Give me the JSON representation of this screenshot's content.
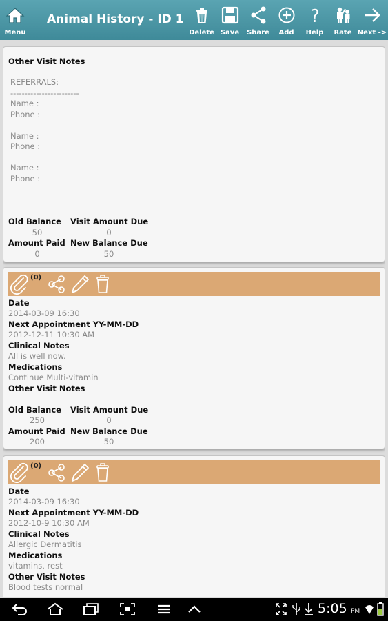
{
  "header": {
    "menu_label": "Menu",
    "title": "Animal History - ID 1",
    "actions": [
      {
        "label": "Delete",
        "icon": "trash-icon"
      },
      {
        "label": "Save",
        "icon": "floppy-icon"
      },
      {
        "label": "Share",
        "icon": "share-icon"
      },
      {
        "label": "Add",
        "icon": "plus-circle-icon"
      },
      {
        "label": "Help",
        "icon": "question-icon"
      },
      {
        "label": "Rate",
        "icon": "rate-people-icon"
      },
      {
        "label": "Next ->",
        "icon": "arrow-right-icon"
      }
    ]
  },
  "labels": {
    "date": "Date",
    "next_appointment": "Next Appointment YY-MM-DD",
    "clinical_notes": "Clinical Notes",
    "medications": "Medications",
    "other_visit_notes": "Other Visit Notes",
    "old_balance": "Old Balance",
    "visit_amount_due": "Visit Amount Due",
    "amount_paid": "Amount Paid",
    "new_balance_due": "New Balance Due"
  },
  "first_card": {
    "notes_text": "REFERRALS:\n------------------------\nName :\nPhone :\n\nName :\nPhone :\n\nName :\nPhone :",
    "old_balance": "50",
    "visit_amount_due": "0",
    "amount_paid": "0",
    "new_balance_due": "50"
  },
  "visits": [
    {
      "attachments": "(0)",
      "date": "2014-03-09 16:30",
      "next_appointment": "2012-12-11  10:30 AM",
      "clinical_notes": "All is well now.",
      "medications": "Continue Multi-vitamin",
      "other_visit_notes": "",
      "old_balance": "250",
      "visit_amount_due": "0",
      "amount_paid": "200",
      "new_balance_due": "50"
    },
    {
      "attachments": "(0)",
      "date": "2014-03-09 16:30",
      "next_appointment": "2012-10-9  10:30 AM",
      "clinical_notes": "Allergic Dermatitis",
      "medications": "vitamins, rest",
      "other_visit_notes": "Blood tests normal"
    }
  ],
  "status_bar": {
    "time": "5:05",
    "ampm": "PM"
  },
  "colors": {
    "actionbar": "#4a97a6",
    "toolstrip": "#dba874",
    "card": "#f6f6f6"
  }
}
